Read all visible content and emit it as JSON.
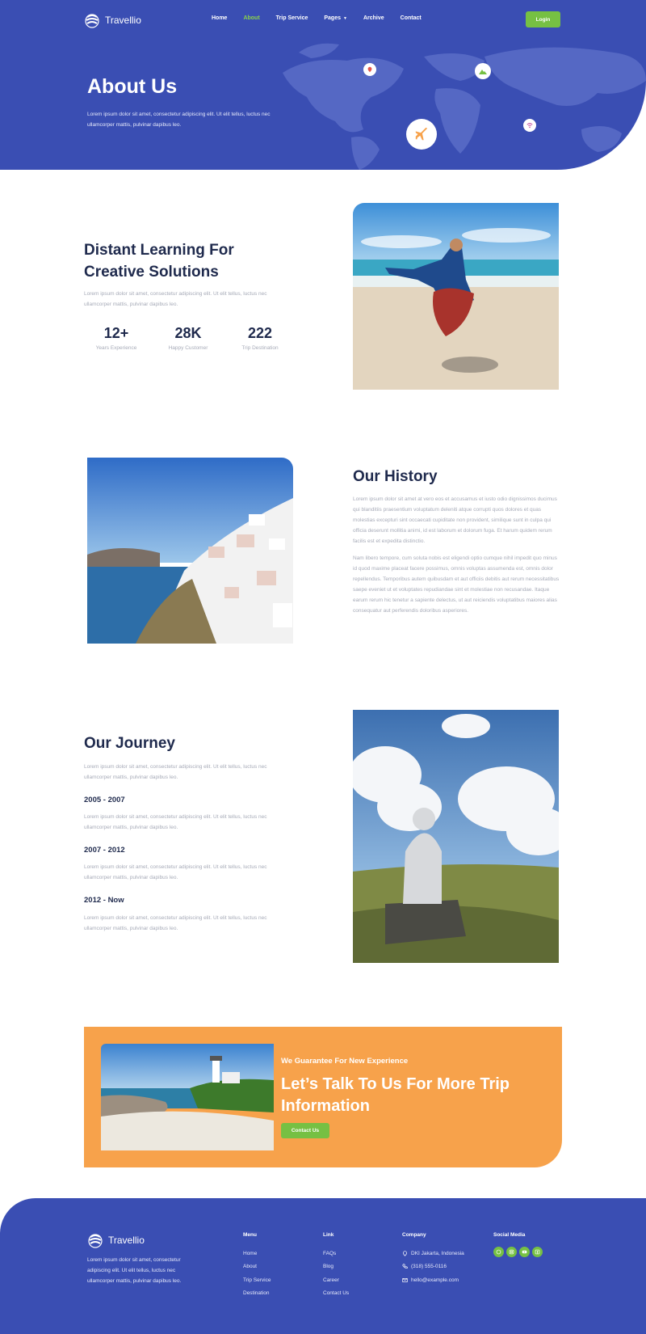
{
  "brand": {
    "name": "Travellio"
  },
  "nav": {
    "items": [
      "Home",
      "About",
      "Trip Service",
      "Pages",
      "Archive",
      "Contact"
    ],
    "active": "About",
    "login_label": "Login"
  },
  "hero": {
    "title": "About Us",
    "text": "Lorem ipsum dolor sit amet, consectetur adipiscing elit. Ut elit tellus, luctus nec ullamcorper mattis, pulvinar dapibus leo."
  },
  "learning": {
    "title_line1": "Distant Learning For",
    "title_line2": "Creative Solutions",
    "text": "Lorem ipsum dolor sit amet, consectetur adipiscing elit. Ut elit tellus, luctus nec ullamcorper mattis, pulvinar dapibus leo.",
    "stats": [
      {
        "value": "12+",
        "label": "Years Experience"
      },
      {
        "value": "28K",
        "label": "Happy Customer"
      },
      {
        "value": "222",
        "label": "Trip Destination"
      }
    ]
  },
  "history": {
    "title": "Our History",
    "p1": "Lorem ipsum dolor sit amet at vero eos et accusamus et iusto odio dignissimos ducimus qui blanditiis praesentium voluptatum deleniti atque corrupti quos dolores et quas molestias excepturi sint occaecati cupiditate non provident, similique sunt in culpa qui officia deserunt mollitia animi, id est laborum et dolorum fuga. Et harum quidem rerum facilis est et expedita distinctio.",
    "p2": "Nam libero tempore, cum soluta nobis est eligendi optio cumque nihil impedit quo minus id quod maxime placeat facere possimus, omnis voluptas assumenda est, omnis dolor repellendus. Temporibus autem quibusdam et aut officiis debitis aut rerum necessitatibus saepe eveniet ut et voluptates repudiandae sint et molestiae non recusandae. Itaque earum rerum hic tenetur a sapiente delectus, ut aut reiciendis voluptatibus maiores alias consequatur aut perferendis doloribus asperiores."
  },
  "journey": {
    "title": "Our Journey",
    "text": "Lorem ipsum dolor sit amet, consectetur adipiscing elit. Ut elit tellus, luctus nec ullamcorper mattis, pulvinar dapibus leo.",
    "periods": [
      {
        "label": "2005 - 2007",
        "text": "Lorem ipsum dolor sit amet, consectetur adipiscing elit. Ut elit tellus, luctus nec ullamcorper mattis, pulvinar dapibus leo."
      },
      {
        "label": "2007 - 2012",
        "text": "Lorem ipsum dolor sit amet, consectetur adipiscing elit. Ut elit tellus, luctus nec ullamcorper mattis, pulvinar dapibus leo."
      },
      {
        "label": "2012 - Now",
        "text": "Lorem ipsum dolor sit amet, consectetur adipiscing elit. Ut elit tellus, luctus nec ullamcorper mattis, pulvinar dapibus leo."
      }
    ]
  },
  "cta": {
    "kicker": "We Guarantee For New Experience",
    "title_line1": "Let’s Talk To Us For More Trip",
    "title_line2": "Information",
    "button_label": "Contact Us"
  },
  "footer": {
    "text": "Lorem ipsum dolor sit amet, consectetur adipiscing elit. Ut elit tellus, luctus nec ullamcorper mattis, pulvinar dapibus leo.",
    "menu": {
      "heading": "Menu",
      "items": [
        "Home",
        "About",
        "Trip Service",
        "Destination"
      ]
    },
    "link": {
      "heading": "Link",
      "items": [
        "FAQs",
        "Blog",
        "Career",
        "Contact Us"
      ]
    },
    "company": {
      "heading": "Company",
      "address": "DKI Jakarta, Indonesia",
      "phone": "(318) 555-0116",
      "email": "hello@example.com"
    },
    "social": {
      "heading": "Social Media",
      "icons": [
        "dribbble-icon",
        "instagram-icon",
        "youtube-icon",
        "facebook-icon"
      ]
    }
  },
  "colors": {
    "primary": "#3a4eb3",
    "accent_green": "#76c043",
    "accent_orange": "#f7a24b",
    "heading": "#1f2a4d",
    "muted": "#a7abb8"
  }
}
